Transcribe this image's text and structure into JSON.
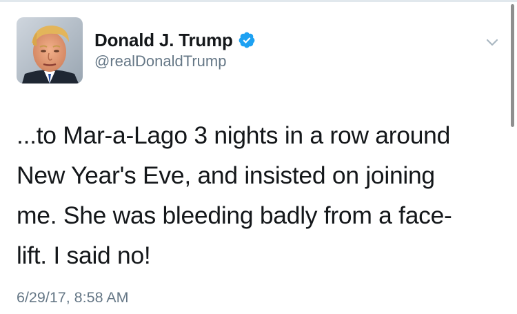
{
  "author": {
    "display_name": "Donald J. Trump",
    "handle": "@realDonaldTrump",
    "verified": true
  },
  "tweet": {
    "lines": [
      "...to Mar-a-Lago 3 nights in a row around",
      "New Year's Eve, and insisted on joining",
      "me. She was bleeding badly from a face-",
      "lift. I said no!"
    ],
    "timestamp": "6/29/17, 8:58 AM"
  },
  "icons": {
    "verified": "verified-badge-icon",
    "more": "chevron-down-icon"
  },
  "colors": {
    "name": "#14171a",
    "secondary": "#657786",
    "verified": "#1da1f2",
    "caret": "#aab8c2"
  }
}
